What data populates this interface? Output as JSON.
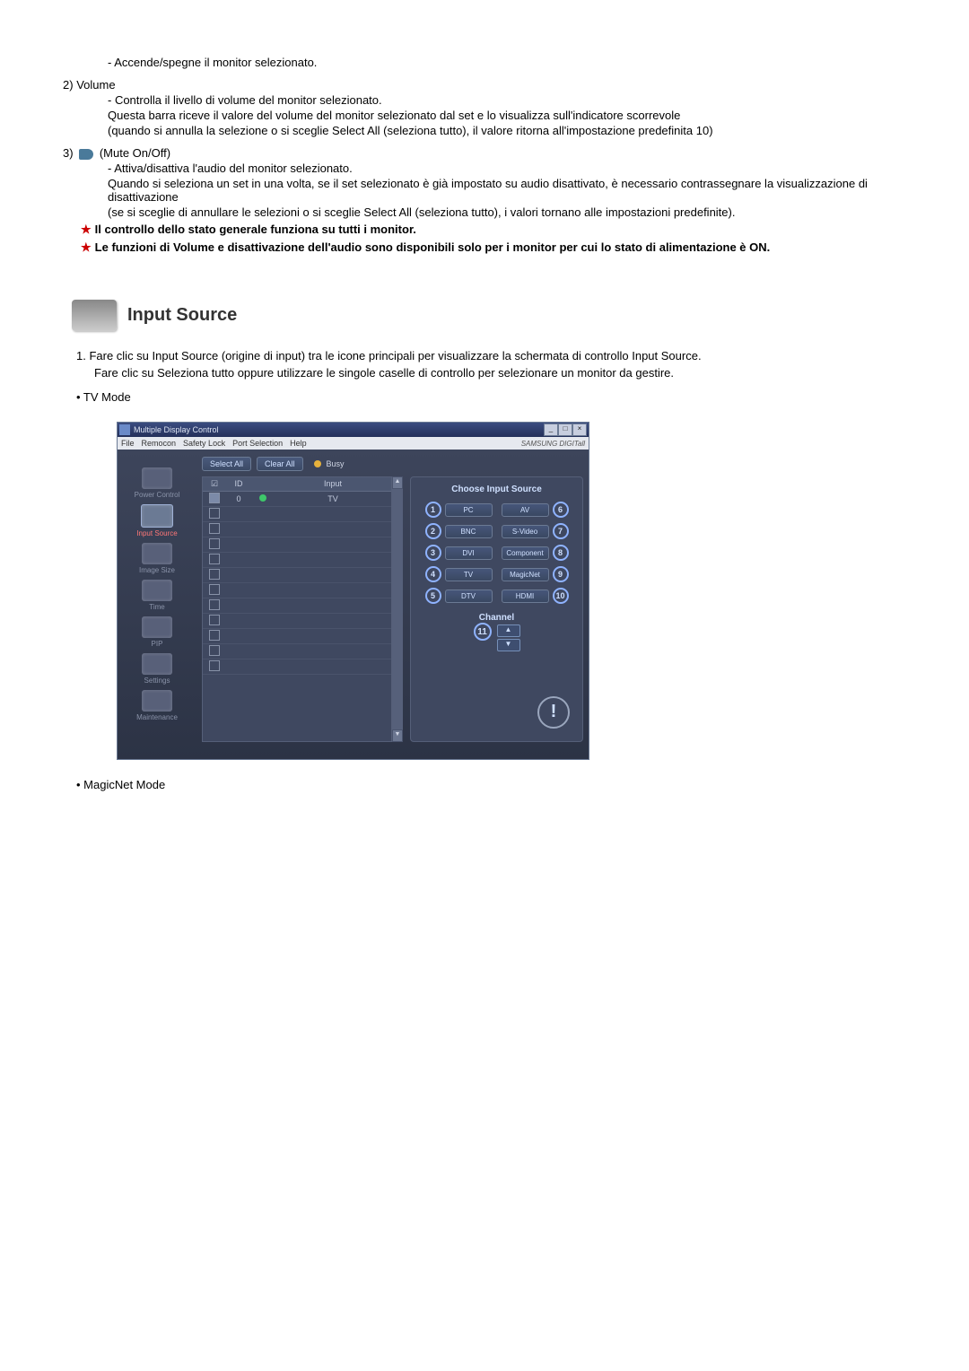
{
  "text": {
    "line1": "- Accende/spegne il monitor selezionato.",
    "vol_num": "2)",
    "vol": "Volume",
    "vol1": "- Controlla il livello di volume del monitor selezionato.",
    "vol2": "Questa barra riceve il valore del volume del monitor selezionato dal set e lo visualizza sull'indicatore scorrevole",
    "vol3": "(quando si annulla la selezione o si sceglie Select All (seleziona tutto), il valore ritorna all'impostazione predefinita 10)",
    "mute_num": "3)",
    "mute": "(Mute On/Off)",
    "mute1": "- Attiva/disattiva l'audio del monitor selezionato.",
    "mute2": "Quando si seleziona un set in una volta, se il set selezionato è già impostato su audio disattivato, è necessario contrassegnare la visualizzazione di disattivazione",
    "mute3": "(se si sceglie di annullare le selezioni o si sceglie Select All (seleziona tutto), i valori tornano alle impostazioni predefinite).",
    "note1": "Il controllo dello stato generale funziona su tutti i monitor.",
    "note2": "Le funzioni di Volume e disattivazione dell'audio sono disponibili solo per i monitor per cui lo stato di alimentazione è ON.",
    "section_title": "Input Source",
    "ol1": "1.  Fare clic su Input Source (origine di input) tra le icone principali per visualizzare la schermata di controllo Input Source.",
    "ol1b": "Fare clic su Seleziona tutto oppure utilizzare le singole caselle di controllo per selezionare un monitor da gestire.",
    "bullet_tv": "• TV Mode",
    "bullet_magic": "• MagicNet Mode"
  },
  "window": {
    "title": "Multiple Display Control",
    "menu": [
      "File",
      "Remocon",
      "Safety Lock",
      "Port Selection",
      "Help"
    ],
    "brand": "SAMSUNG DIGITall",
    "toolbar": {
      "select": "Select All",
      "clear": "Clear All",
      "busy": "Busy"
    },
    "sidebar": [
      "Power Control",
      "Input Source",
      "Image Size",
      "Time",
      "PIP",
      "Settings",
      "Maintenance"
    ],
    "table": {
      "headers": [
        "☑",
        "ID",
        "",
        "Input"
      ],
      "row": {
        "id": "0",
        "input": "TV"
      }
    },
    "panel": {
      "title": "Choose Input Source",
      "left": [
        {
          "n": "1",
          "l": "PC"
        },
        {
          "n": "2",
          "l": "BNC"
        },
        {
          "n": "3",
          "l": "DVI"
        },
        {
          "n": "4",
          "l": "TV"
        },
        {
          "n": "5",
          "l": "DTV"
        }
      ],
      "right": [
        {
          "n": "6",
          "l": "AV"
        },
        {
          "n": "7",
          "l": "S-Video"
        },
        {
          "n": "8",
          "l": "Component"
        },
        {
          "n": "9",
          "l": "MagicNet"
        },
        {
          "n": "10",
          "l": "HDMI"
        }
      ],
      "channel": "Channel",
      "ch_num": "11",
      "up": "▲",
      "down": "▼"
    }
  }
}
